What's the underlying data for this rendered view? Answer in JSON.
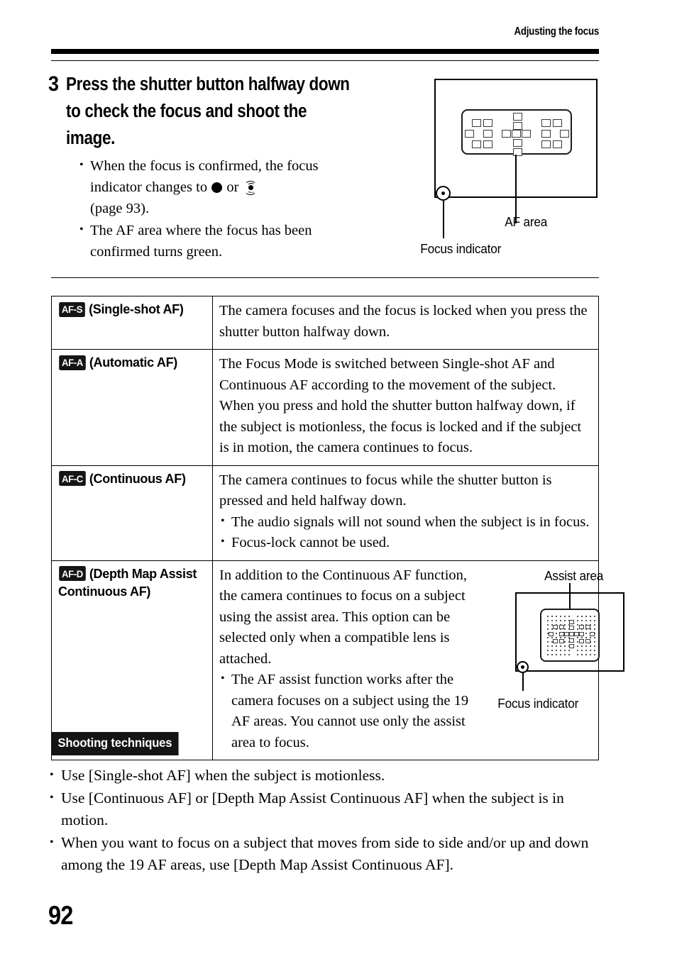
{
  "header": {
    "running_title": "Adjusting the focus"
  },
  "step": {
    "number": "3",
    "title": "Press the shutter button halfway down to check the focus and shoot the image.",
    "bullets": [
      {
        "before": "When the focus is confirmed, the focus indicator changes to",
        "middle": "or",
        "after": "(page 93).",
        "icons": [
          "solid-circle-focus-icon",
          "flashing-focus-icon"
        ]
      },
      {
        "text": "The AF area where the focus has been confirmed turns green."
      }
    ]
  },
  "top_diagram": {
    "af_area_label": "AF area",
    "focus_indicator_label": "Focus indicator",
    "af_point_count": 19
  },
  "table": {
    "rows": [
      {
        "badge": "AF-S",
        "mode": "(Single-shot AF)",
        "paragraphs": [
          "The camera focuses and the focus is locked when you press the shutter button halfway down."
        ],
        "bullets": []
      },
      {
        "badge": "AF-A",
        "mode": "(Automatic AF)",
        "paragraphs": [
          "The Focus Mode is switched between Single-shot AF and Continuous AF according to the movement of the subject. When you press and hold the shutter button halfway down, if the subject is motionless, the focus is locked and if the subject is in motion, the camera continues to focus."
        ],
        "bullets": []
      },
      {
        "badge": "AF-C",
        "mode": "(Continuous AF)",
        "paragraphs": [
          "The camera continues to focus while the shutter button is pressed and held halfway down."
        ],
        "bullets": [
          "The audio signals will not sound when the subject is in focus.",
          "Focus-lock cannot be used."
        ]
      },
      {
        "badge": "AF-D",
        "mode": "(Depth Map Assist Continuous AF)",
        "paragraphs": [
          "In addition to the Continuous AF function, the camera continues to focus on a subject using the assist area. This option can be selected only when a compatible lens is attached."
        ],
        "bullets": [
          "The AF assist function works after the camera focuses on a subject using the 19 AF areas. You cannot use only the assist area to focus."
        ]
      }
    ]
  },
  "assist_diagram": {
    "assist_area_label": "Assist area",
    "focus_indicator_label": "Focus indicator"
  },
  "shooting_techniques": {
    "heading": "Shooting techniques",
    "bullets": [
      "Use [Single-shot AF] when the subject is motionless.",
      "Use [Continuous AF] or [Depth Map Assist Continuous AF] when the subject is in motion.",
      "When you want to focus on a subject that moves from side to side and/or up and down among the 19 AF areas, use [Depth Map Assist Continuous AF]."
    ]
  },
  "page_number": "92",
  "colors": {
    "ink": "#000000",
    "badge_bg": "#151515",
    "badge_fg": "#ffffff",
    "paper": "#ffffff"
  }
}
